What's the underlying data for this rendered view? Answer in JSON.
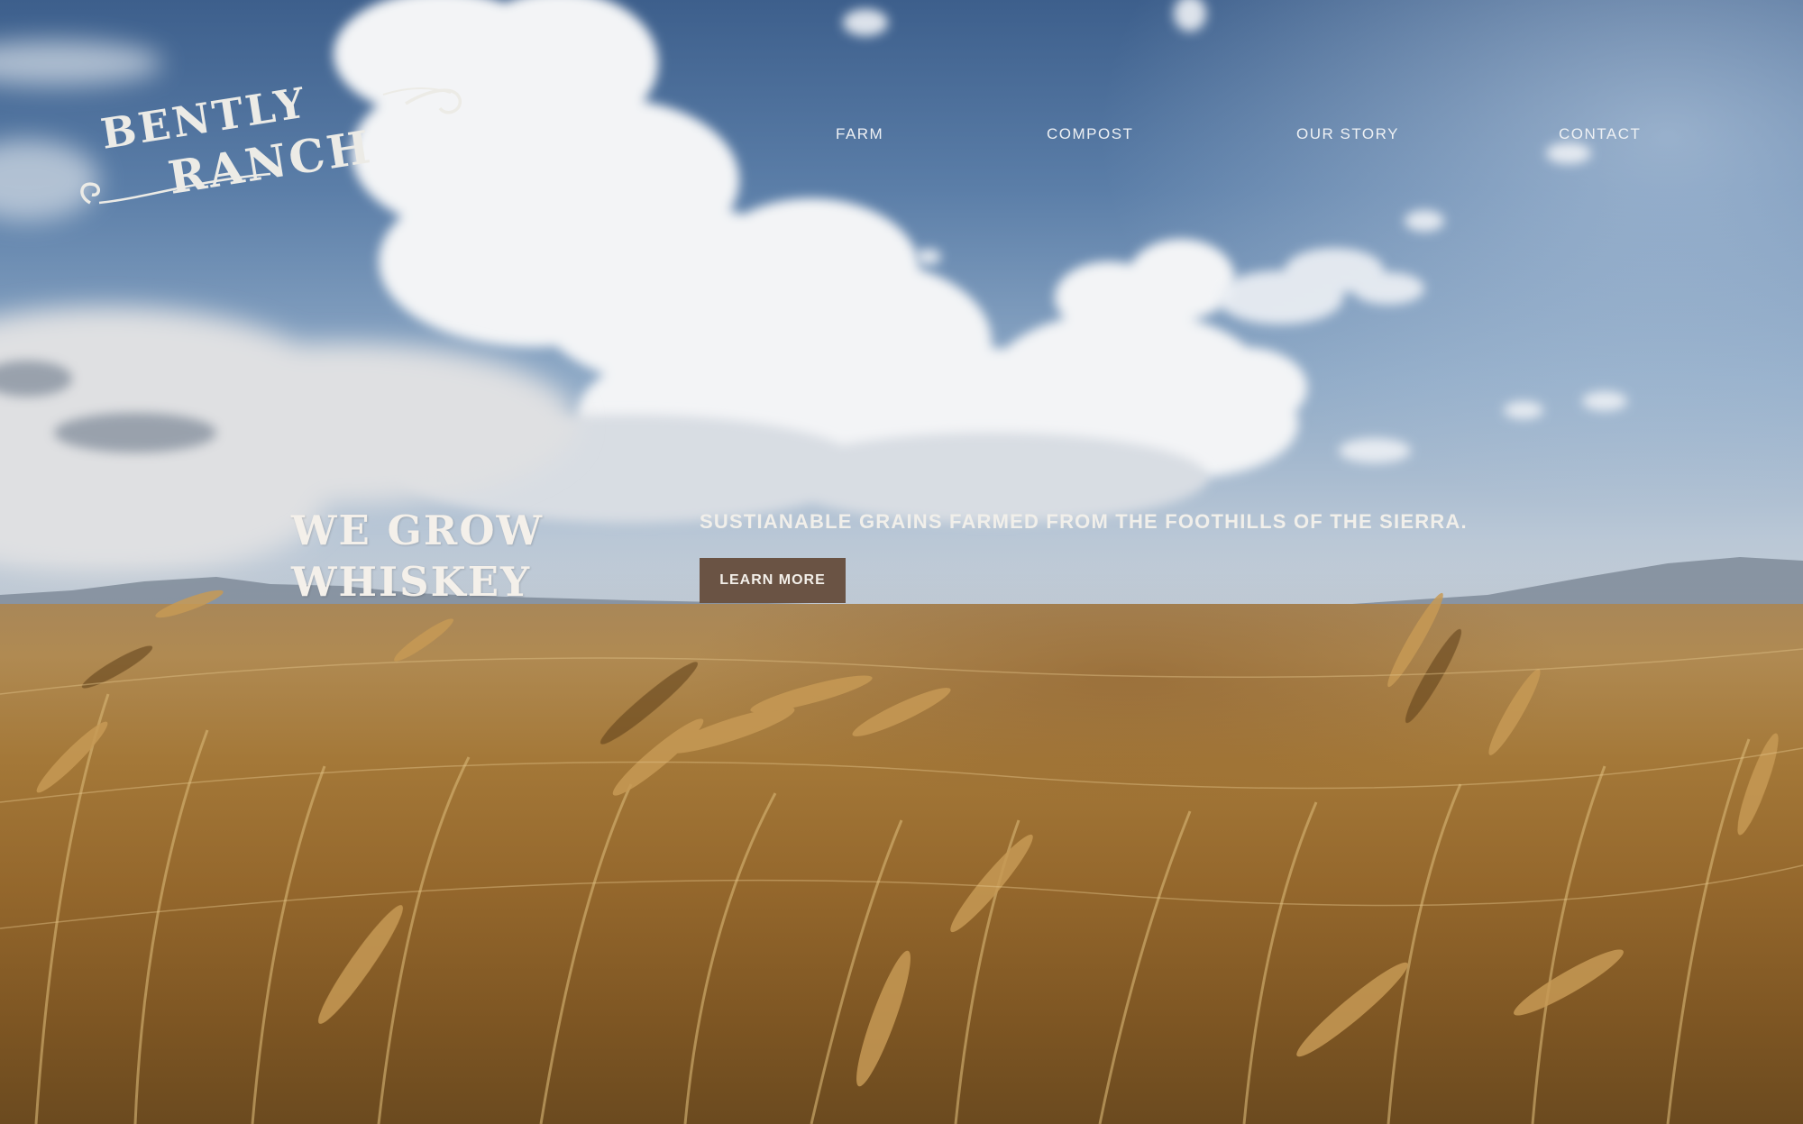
{
  "brand": {
    "logo_line1": "BENTLY",
    "logo_line2": "RANCH"
  },
  "nav": {
    "items": [
      {
        "label": "FARM"
      },
      {
        "label": "COMPOST"
      },
      {
        "label": "OUR STORY"
      },
      {
        "label": "CONTACT"
      }
    ]
  },
  "hero": {
    "headline_line1": "WE GROW",
    "headline_line2": "WHISKEY",
    "tagline": "SUSTIANABLE GRAINS FARMED FROM THE FOOTHILLS OF THE SIERRA.",
    "cta_label": "LEARN MORE"
  },
  "colors": {
    "cta_background": "#6a5344",
    "text_light": "#f4f0ea",
    "sky_blue": "#4a6c98",
    "wheat_gold": "#a47838"
  }
}
